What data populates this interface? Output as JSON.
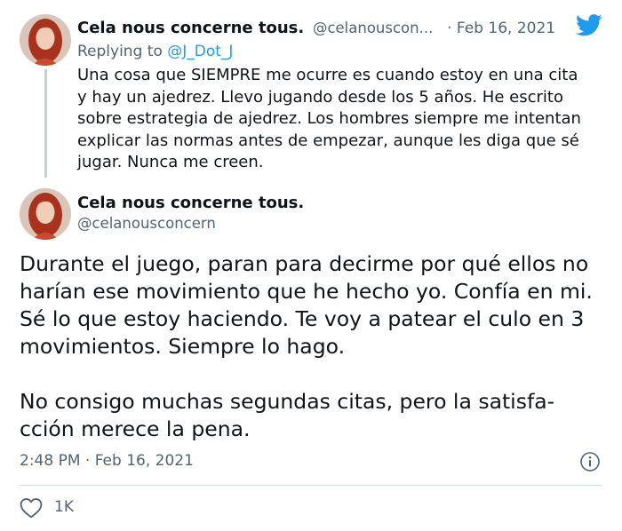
{
  "reply_tweet": {
    "display_name": "Cela nous concerne tous.",
    "handle": "@celanouscon...",
    "date": "· Feb 16, 2021",
    "replying_prefix": "Replying to",
    "replying_to": "@J_Dot_J",
    "text": "Una cosa que SIEMPRE me ocurre es cuando estoy en una cita y hay un ajedrez. Llevo jugando desde los 5 años. He escrito sobre estrategia de ajedrez. Los hombres siempre me intentan explicar las normas antes de empezar, aunque les diga que sé jugar. Nunca me creen."
  },
  "main_tweet": {
    "display_name": "Cela nous concerne tous.",
    "handle": "@celanousconcern",
    "paragraph_1": "Durante el juego, paran para decirme por qué ellos no harían ese movimiento que he hecho yo. Confía en mi. Sé lo que estoy haciendo. Te voy a patear el culo en 3 movimientos. Siempre lo hago.",
    "paragraph_2": "No consigo muchas segundas citas, pero la satisfa-cción merece la pena.",
    "timestamp": "2:48 PM · Feb 16, 2021",
    "like_count": "1K"
  },
  "icons": {
    "brand": "twitter-bird-icon",
    "info": "info-icon",
    "like": "heart-icon"
  },
  "colors": {
    "brand_blue": "#1d9bf0",
    "text_primary": "#0f1419",
    "text_secondary": "#536471",
    "thread_line": "#c4cfd6"
  }
}
